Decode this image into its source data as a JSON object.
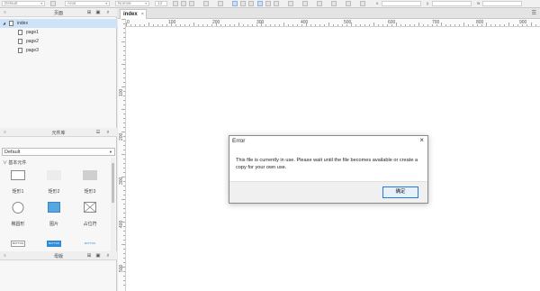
{
  "toolbar": {
    "style_value": "Default",
    "font_value": "Arial",
    "weight_value": "Normal",
    "size_value": "13",
    "x_label": "x",
    "y_label": "y",
    "w_label": "w"
  },
  "pages_panel": {
    "title": "页面",
    "tree": [
      {
        "label": "index",
        "selected": true
      },
      {
        "label": "page1"
      },
      {
        "label": "page2"
      },
      {
        "label": "page3"
      }
    ]
  },
  "library_panel": {
    "title": "元件库",
    "selected_library": "Default",
    "category": "基本元件",
    "widgets": [
      {
        "label": "矩形1",
        "shape": "rect-outline"
      },
      {
        "label": "矩形2",
        "shape": "rect-light"
      },
      {
        "label": "矩形3",
        "shape": "rect-gray"
      },
      {
        "label": "椭圆形",
        "shape": "ellipse"
      },
      {
        "label": "图片",
        "shape": "image"
      },
      {
        "label": "占位符",
        "shape": "placeholder"
      },
      {
        "label": "BUTTON",
        "shape": "btn-outline"
      },
      {
        "label": "BUTTON",
        "shape": "btn-primary"
      },
      {
        "label": "BUTTON",
        "shape": "btn-link"
      }
    ]
  },
  "masters_panel": {
    "title": "母版"
  },
  "canvas": {
    "tab_label": "index",
    "ruler_h": [
      "0",
      "100",
      "200",
      "300",
      "400",
      "500",
      "600",
      "700",
      "800",
      "900"
    ],
    "ruler_v": [
      "100",
      "200",
      "300",
      "400",
      "500"
    ]
  },
  "dialog": {
    "title": "Error",
    "message": "This file is currently in use. Please wait until the file becomes available or create a copy for your own use.",
    "ok_label": "确定"
  }
}
